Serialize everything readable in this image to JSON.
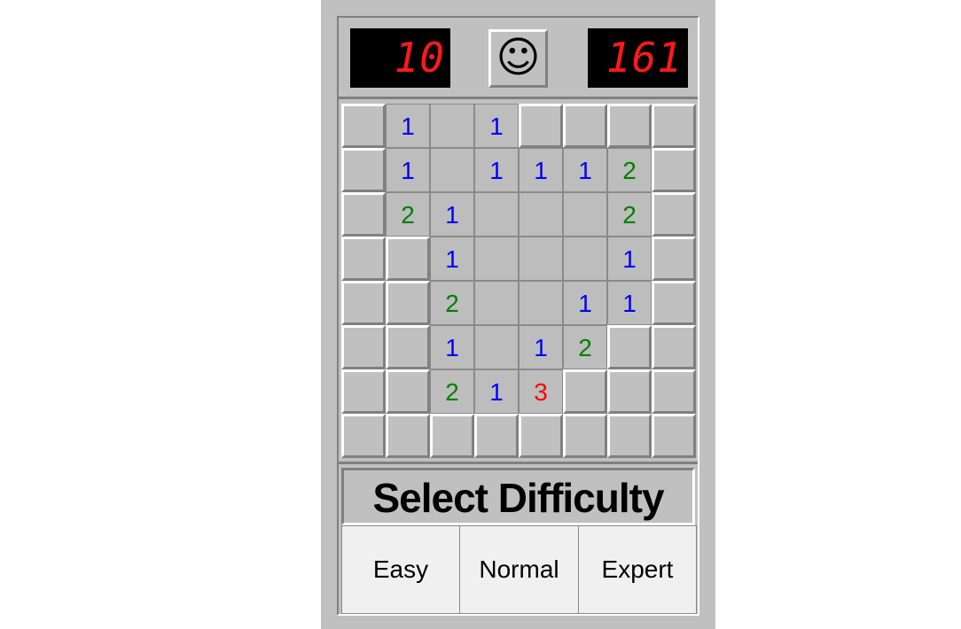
{
  "header": {
    "mine_count": "10",
    "timer": "161",
    "face": "☺"
  },
  "colors": {
    "1": "#0000ff",
    "2": "#008000",
    "3": "#ff0000"
  },
  "board": [
    [
      "c",
      "1",
      "",
      "1",
      "c",
      "c",
      "c",
      "c"
    ],
    [
      "c",
      "1",
      "",
      "1",
      "1",
      "1",
      "2",
      "c"
    ],
    [
      "c",
      "2",
      "1",
      "",
      "",
      "",
      "2",
      "c"
    ],
    [
      "c",
      "c",
      "1",
      "",
      "",
      "",
      "1",
      "c"
    ],
    [
      "c",
      "c",
      "2",
      "",
      "",
      "1",
      "1",
      "c"
    ],
    [
      "c",
      "c",
      "1",
      "",
      "1",
      "2",
      "c",
      "c"
    ],
    [
      "c",
      "c",
      "2",
      "1",
      "3",
      "c",
      "c",
      "c"
    ],
    [
      "c",
      "c",
      "c",
      "c",
      "c",
      "c",
      "c",
      "c"
    ]
  ],
  "difficulty": {
    "title": "Select Difficulty",
    "easy": "Easy",
    "normal": "Normal",
    "expert": "Expert"
  }
}
